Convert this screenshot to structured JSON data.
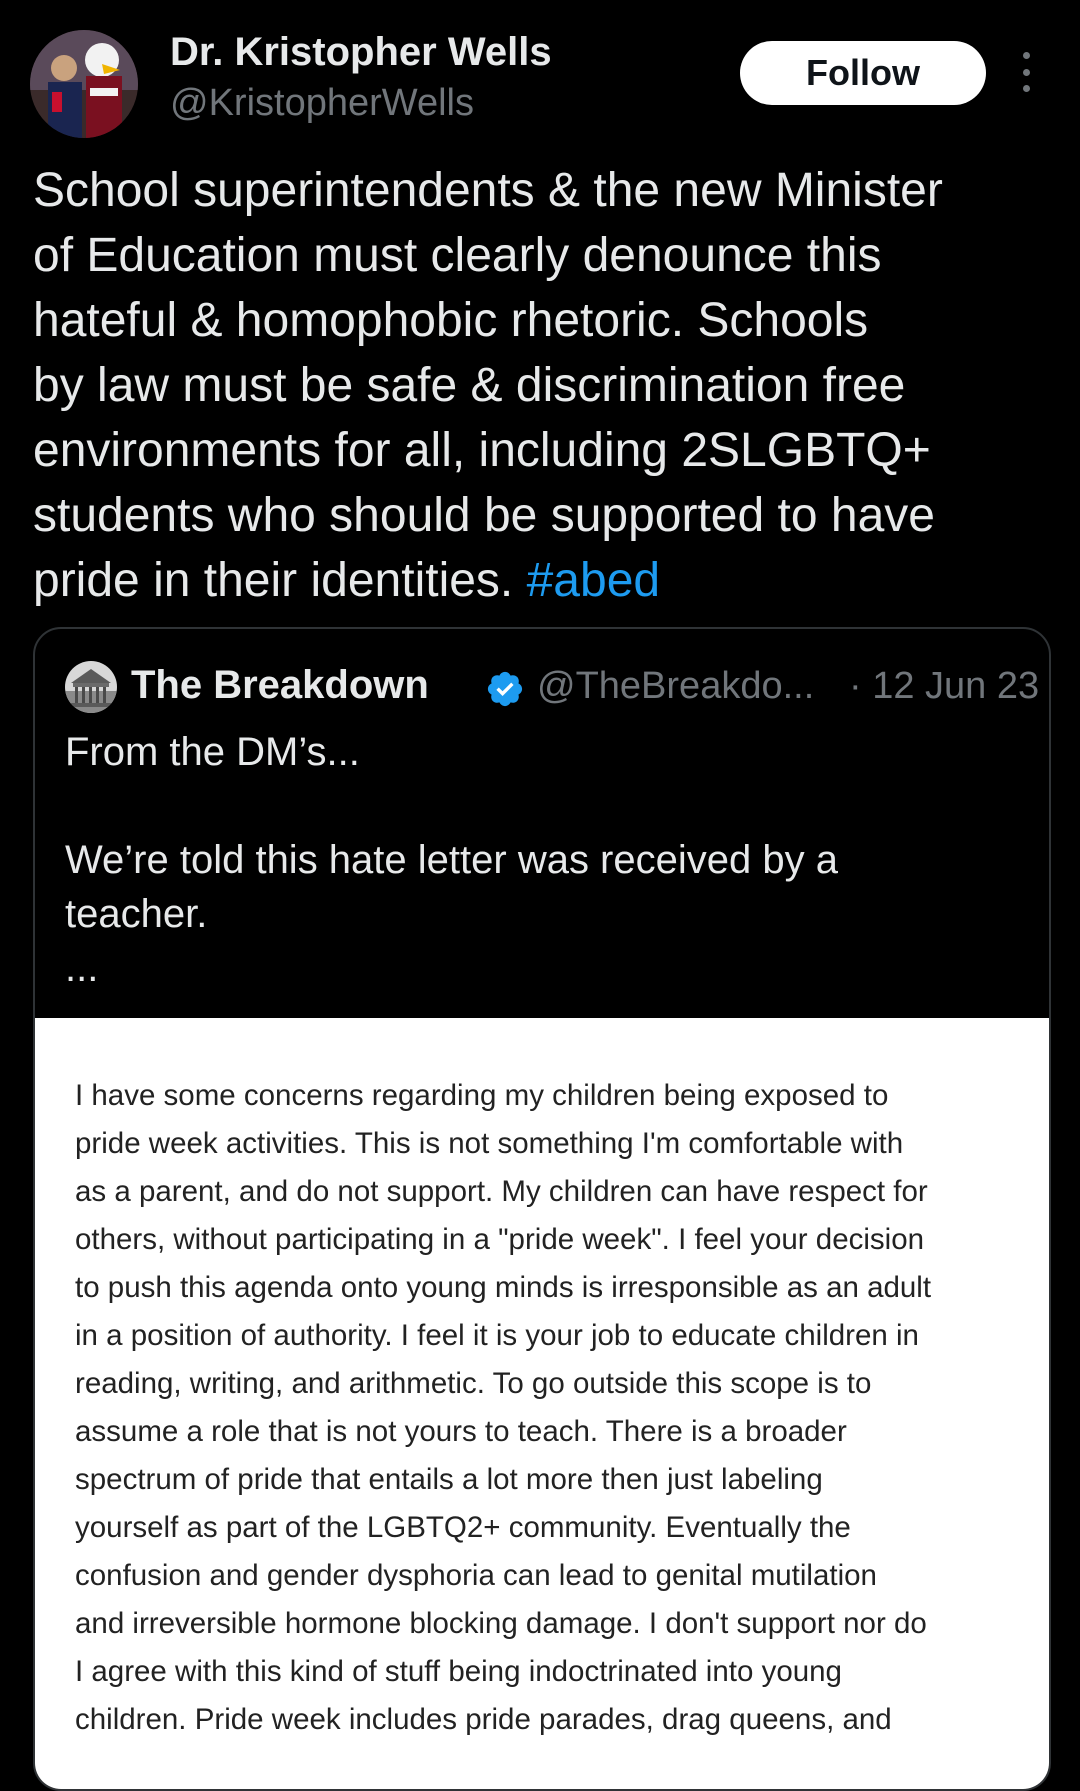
{
  "author": {
    "display_name": "Dr. Kristopher Wells",
    "handle": "@KristopherWells"
  },
  "follow_button": {
    "label": "Follow"
  },
  "tweet": {
    "text_lines": [
      "School superintendents & the new Minister",
      "of Education must clearly denounce this",
      "hateful & homophobic rhetoric. Schools",
      "by law must be safe & discrimination free",
      "environments for all, including 2SLGBTQ+",
      "students who should be supported to have",
      "pride in their identities."
    ],
    "hashtag": "#abed"
  },
  "quoted_tweet": {
    "display_name": "The Breakdown",
    "handle": "@TheBreakdo...",
    "date": "· 12 Jun 23",
    "text_line_1": "From the DM’s...",
    "text_line_2": "We’re told this hate letter was received by a",
    "text_line_3": "teacher.",
    "ellipsis": "..."
  },
  "letter_image": {
    "lines": [
      "I have some concerns regarding my children being exposed to",
      "pride week activities.  This is not something I'm comfortable with",
      "as a parent, and do not support.  My children can have respect for",
      "others, without participating in a \"pride week\".  I feel your decision",
      "to push this agenda onto young minds is irresponsible as an adult",
      "in a position of authority.  I feel it is your job to educate children in",
      "reading, writing, and arithmetic.  To go outside this scope is to",
      "assume a role that is not yours to teach. There is a broader",
      "spectrum of pride that entails a lot more then just labeling",
      "yourself as part of the LGBTQ2+ community.  Eventually the",
      "confusion and gender dysphoria can lead to genital mutilation",
      "and irreversible hormone blocking damage.  I don't support nor do",
      "I agree with this kind of stuff being indoctrinated into young",
      "children.  Pride week includes pride parades, drag queens, and"
    ]
  },
  "colors": {
    "background": "#000000",
    "text_primary": "#e7e9ea",
    "text_secondary": "#71767b",
    "link": "#1d9bf0",
    "verified_badge": "#1d9bf0",
    "card_border": "#2f3336"
  }
}
